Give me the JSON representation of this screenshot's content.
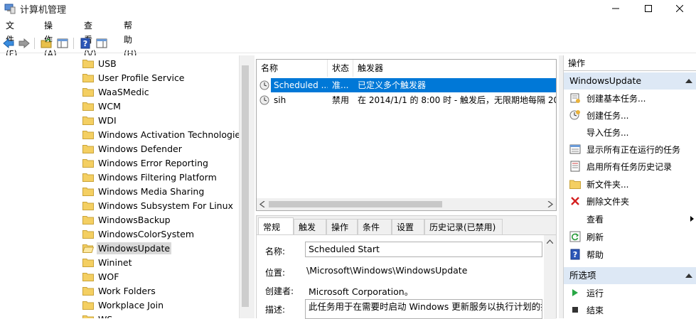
{
  "window": {
    "title": "计算机管理"
  },
  "menu": [
    "文件(F)",
    "操作(A)",
    "查看(V)",
    "帮助(H)"
  ],
  "tree": {
    "items": [
      "USB",
      "User Profile Service",
      "WaaSMedic",
      "WCM",
      "WDI",
      "Windows Activation Technologies",
      "Windows Defender",
      "Windows Error Reporting",
      "Windows Filtering Platform",
      "Windows Media Sharing",
      "Windows Subsystem For Linux",
      "WindowsBackup",
      "WindowsColorSystem",
      "WindowsUpdate",
      "Wininet",
      "WOF",
      "Work Folders",
      "Workplace Join",
      "WS"
    ],
    "selected": "WindowsUpdate"
  },
  "tasks": {
    "columns": [
      "名称",
      "状态",
      "触发器"
    ],
    "rows": [
      {
        "name": "Scheduled ...",
        "status": "准...",
        "trigger": "已定义多个触发器"
      },
      {
        "name": "sih",
        "status": "禁用",
        "trigger": "在 2014/1/1 的 8:00 时 - 触发后，无限期地每隔 20"
      }
    ]
  },
  "properties": {
    "tabs": [
      "常规",
      "触发器",
      "操作",
      "条件",
      "设置",
      "历史记录(已禁用)"
    ],
    "name_label": "名称:",
    "name_value": "Scheduled Start",
    "location_label": "位置:",
    "location_value": "\\Microsoft\\Windows\\WindowsUpdate",
    "author_label": "创建者:",
    "author_value": "Microsoft Corporation。",
    "desc_label": "描述:",
    "desc_value": "此任务用于在需要时启动 Windows 更新服务以执行计划的操作"
  },
  "actions": {
    "title": "操作",
    "section1": "WindowsUpdate",
    "items1": [
      "创建基本任务...",
      "创建任务...",
      "导入任务...",
      "显示所有正在运行的任务",
      "启用所有任务历史记录",
      "新文件夹...",
      "删除文件夹",
      "查看",
      "刷新",
      "帮助"
    ],
    "section2": "所选项",
    "items2": [
      "运行",
      "结束"
    ]
  },
  "colors": {
    "selection": "#0078d7",
    "section_bg": "#dde8f5"
  }
}
